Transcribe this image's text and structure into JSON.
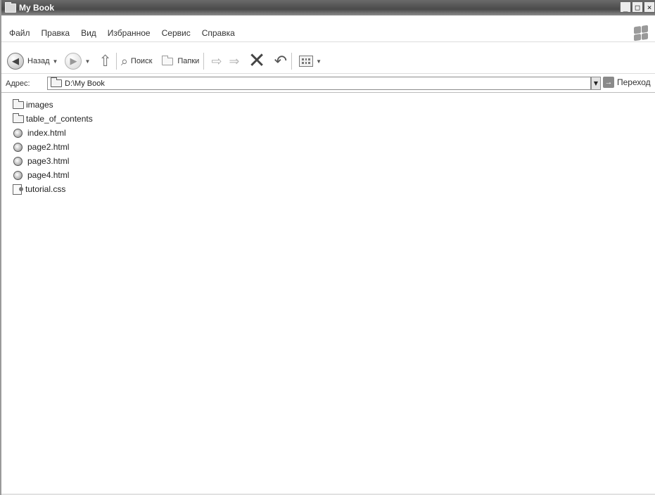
{
  "window": {
    "title": "My Book"
  },
  "window_buttons": {
    "minimize": "_",
    "maximize": "□",
    "close": "×"
  },
  "menu": {
    "items": [
      {
        "label": "Файл"
      },
      {
        "label": "Правка"
      },
      {
        "label": "Вид"
      },
      {
        "label": "Избранное"
      },
      {
        "label": "Сервис"
      },
      {
        "label": "Справка"
      }
    ]
  },
  "toolbar": {
    "back_label": "Назад",
    "search_label": "Поиск",
    "folders_label": "Папки"
  },
  "address": {
    "label": "Адрес:",
    "value": "D:\\My Book",
    "go_label": "Переход"
  },
  "files": [
    {
      "name": "images",
      "icon": "folder-icon"
    },
    {
      "name": "table_of_contents",
      "icon": "folder-icon"
    },
    {
      "name": "index.html",
      "icon": "html-file-icon"
    },
    {
      "name": "page2.html",
      "icon": "html-file-icon"
    },
    {
      "name": "page3.html",
      "icon": "html-file-icon"
    },
    {
      "name": "page4.html",
      "icon": "html-file-icon"
    },
    {
      "name": "tutorial.css",
      "icon": "css-file-icon"
    }
  ],
  "icons": {
    "title": "folder-icon",
    "back": "back-arrow-icon",
    "forward": "forward-arrow-icon",
    "up": "up-folder-icon",
    "search": "search-icon",
    "folders": "folders-icon",
    "move": "move-to-icon",
    "copy": "copy-to-icon",
    "delete": "delete-icon",
    "undo": "undo-icon",
    "views": "views-icon",
    "go": "go-arrow-icon"
  }
}
